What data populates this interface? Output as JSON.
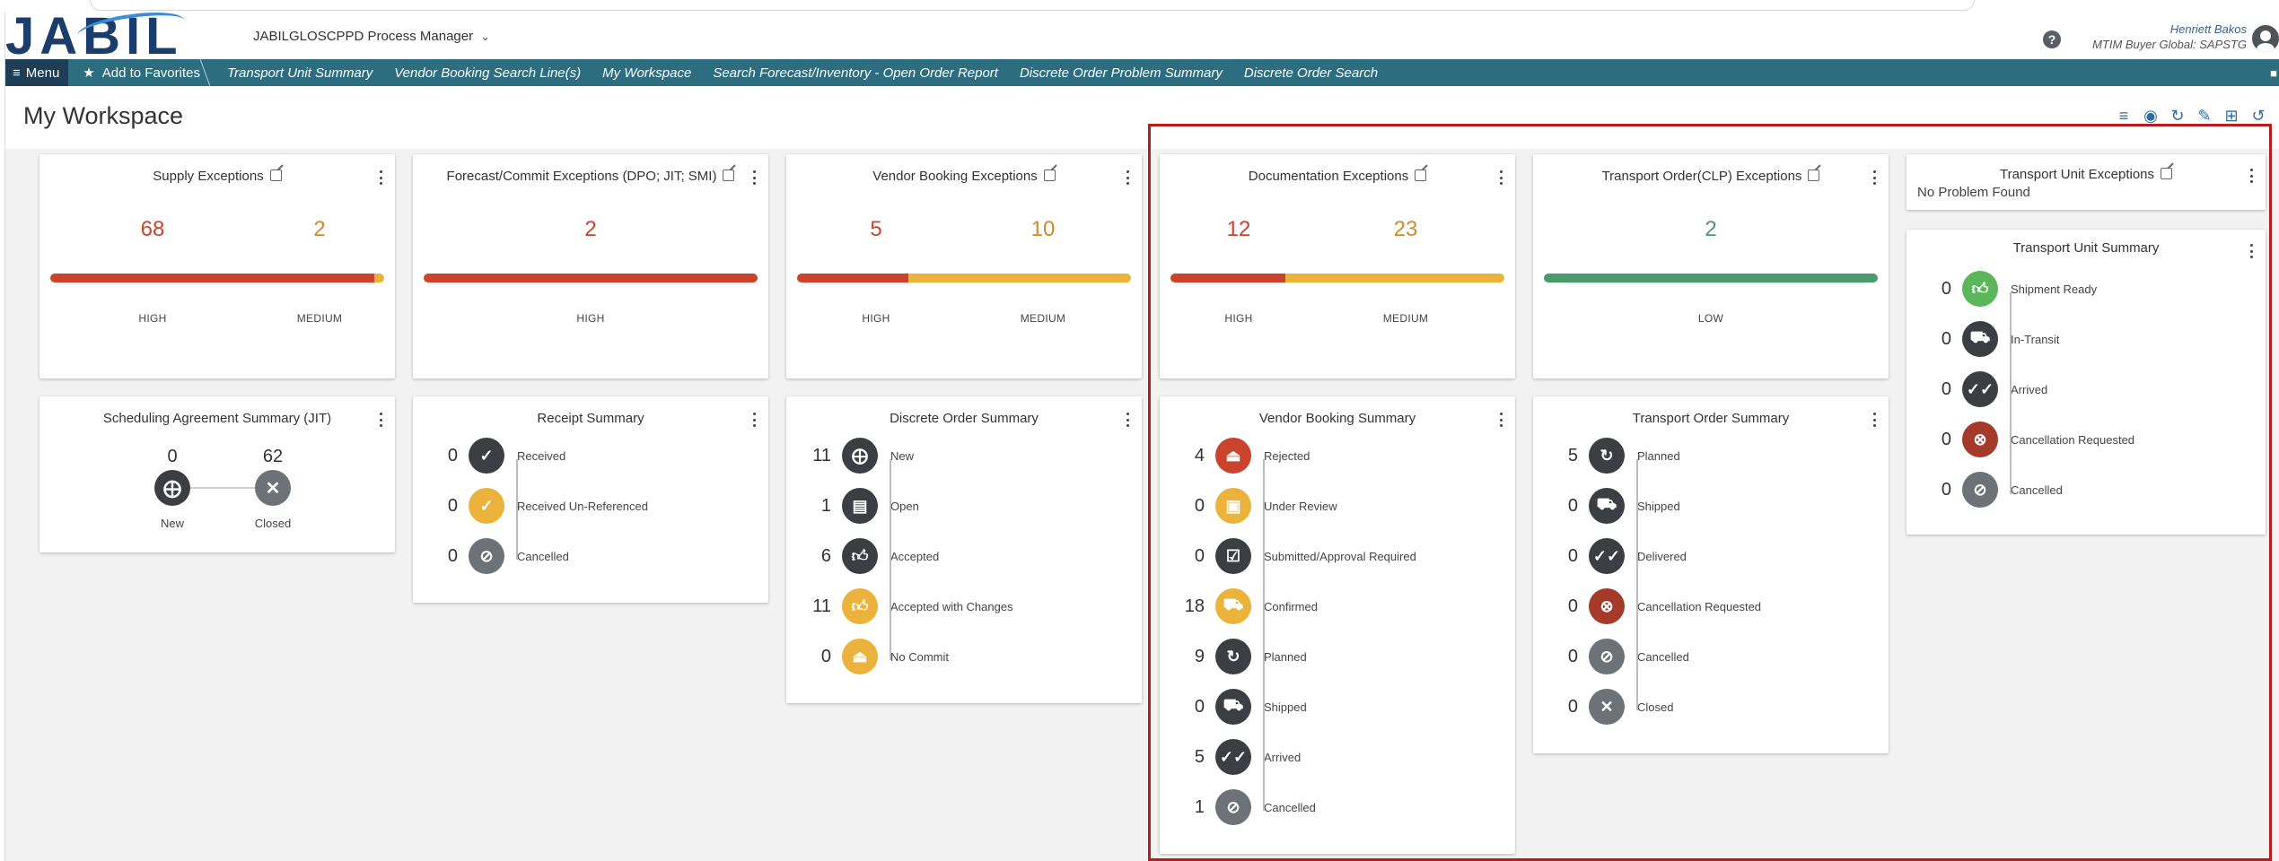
{
  "header": {
    "logo_text": "JABIL",
    "app_name": "JABILGLOSCPPD Process Manager",
    "user_name": "Henriett Bakos",
    "user_role": "MTIM Buyer Global: SAPSTG",
    "help_label": "?"
  },
  "nav": {
    "menu_label": "Menu",
    "favorites_label": "Add to Favorites",
    "links": [
      "Transport Unit Summary",
      "Vendor Booking Search Line(s)",
      "My Workspace",
      "Search Forecast/Inventory - Open Order Report",
      "Discrete Order Problem Summary",
      "Discrete Order Search"
    ]
  },
  "page": {
    "title": "My Workspace"
  },
  "colors": {
    "high": "#c9432d",
    "medium": "#ebb33b",
    "low": "#4a9a6c",
    "nav": "#2c6d7f",
    "menu": "#1d3e56",
    "highlight": "#b61e1e"
  },
  "exceptions": {
    "supply": {
      "title": "Supply Exceptions",
      "high": "68",
      "medium": "2",
      "high_label": "HIGH",
      "medium_label": "MEDIUM",
      "high_share": 0.97
    },
    "forecast": {
      "title": "Forecast/Commit Exceptions (DPO; JIT; SMI)",
      "high": "2",
      "high_label": "HIGH"
    },
    "vendor_booking": {
      "title": "Vendor Booking Exceptions",
      "high": "5",
      "medium": "10",
      "high_label": "HIGH",
      "medium_label": "MEDIUM",
      "high_share": 0.333
    },
    "documentation": {
      "title": "Documentation Exceptions",
      "high": "12",
      "medium": "23",
      "high_label": "HIGH",
      "medium_label": "MEDIUM",
      "high_share": 0.343
    },
    "transport_order": {
      "title": "Transport Order(CLP) Exceptions",
      "low": "2",
      "low_label": "LOW"
    },
    "transport_unit": {
      "title": "Transport Unit Exceptions",
      "message": "No Problem Found"
    }
  },
  "jit": {
    "title": "Scheduling Agreement Summary (JIT)",
    "items": [
      {
        "count": "0",
        "label": "New",
        "icon": "plus-stack-icon"
      },
      {
        "count": "62",
        "label": "Closed",
        "icon": "x-icon"
      }
    ]
  },
  "receipt": {
    "title": "Receipt Summary",
    "items": [
      {
        "count": "0",
        "label": "Received",
        "icon": "check-icon"
      },
      {
        "count": "0",
        "label": "Received Un-Referenced",
        "icon": "check-icon"
      },
      {
        "count": "0",
        "label": "Cancelled",
        "icon": "ban-icon"
      }
    ]
  },
  "discrete": {
    "title": "Discrete Order Summary",
    "items": [
      {
        "count": "11",
        "label": "New",
        "icon": "plus-stack-icon"
      },
      {
        "count": "1",
        "label": "Open",
        "icon": "doc-icon"
      },
      {
        "count": "6",
        "label": "Accepted",
        "icon": "thumbs-up-icon"
      },
      {
        "count": "11",
        "label": "Accepted with Changes",
        "icon": "thumbs-up-icon"
      },
      {
        "count": "0",
        "label": "No Commit",
        "icon": "eject-icon"
      }
    ]
  },
  "vendor_booking": {
    "title": "Vendor Booking Summary",
    "items": [
      {
        "count": "4",
        "label": "Rejected",
        "icon": "eject-icon"
      },
      {
        "count": "0",
        "label": "Under Review",
        "icon": "review-icon"
      },
      {
        "count": "0",
        "label": "Submitted/Approval Required",
        "icon": "calendar-check-icon"
      },
      {
        "count": "18",
        "label": "Confirmed",
        "icon": "truck-icon"
      },
      {
        "count": "9",
        "label": "Planned",
        "icon": "refresh-icon"
      },
      {
        "count": "0",
        "label": "Shipped",
        "icon": "truck-icon"
      },
      {
        "count": "5",
        "label": "Arrived",
        "icon": "double-check-icon"
      },
      {
        "count": "1",
        "label": "Cancelled",
        "icon": "ban-icon"
      }
    ]
  },
  "transport_order": {
    "title": "Transport Order Summary",
    "items": [
      {
        "count": "5",
        "label": "Planned",
        "icon": "refresh-icon"
      },
      {
        "count": "0",
        "label": "Shipped",
        "icon": "truck-icon"
      },
      {
        "count": "0",
        "label": "Delivered",
        "icon": "double-check-icon"
      },
      {
        "count": "0",
        "label": "Cancellation Requested",
        "icon": "x-circle-icon"
      },
      {
        "count": "0",
        "label": "Cancelled",
        "icon": "ban-icon"
      },
      {
        "count": "0",
        "label": "Closed",
        "icon": "x-icon"
      }
    ]
  },
  "transport_unit": {
    "title": "Transport Unit Summary",
    "items": [
      {
        "count": "0",
        "label": "Shipment Ready",
        "icon": "thumbs-up-icon"
      },
      {
        "count": "0",
        "label": "In-Transit",
        "icon": "truck-icon"
      },
      {
        "count": "0",
        "label": "Arrived",
        "icon": "double-check-icon"
      },
      {
        "count": "0",
        "label": "Cancellation Requested",
        "icon": "x-circle-icon"
      },
      {
        "count": "0",
        "label": "Cancelled",
        "icon": "ban-icon"
      }
    ]
  }
}
